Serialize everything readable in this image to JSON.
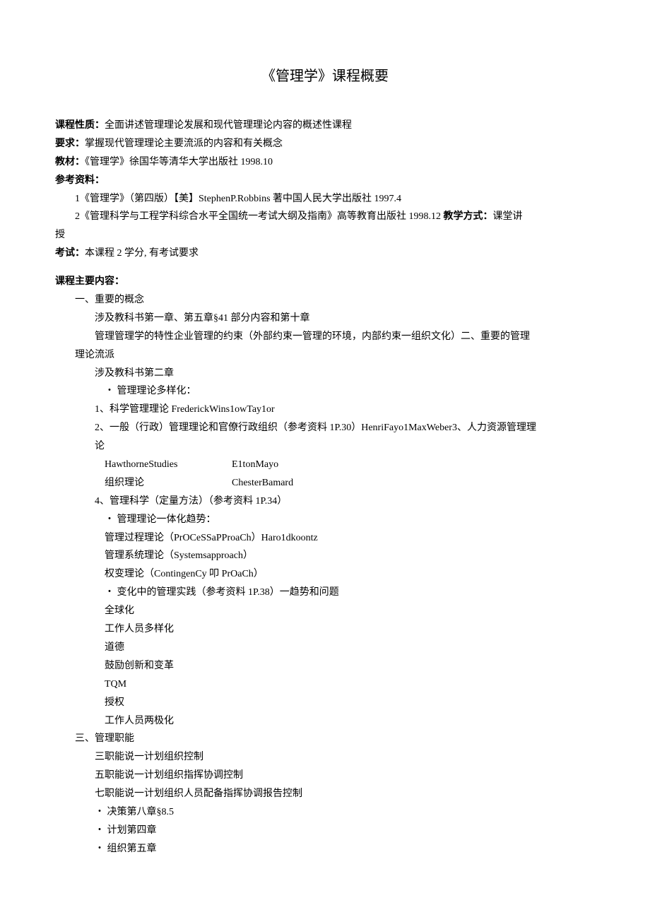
{
  "title": "《管理学》课程概要",
  "header": {
    "nature_label": "课程性质：",
    "nature_value": "全面讲述管理理论发展和现代管理理论内容的概述性课程",
    "req_label": "要求：",
    "req_value": "掌握现代管理理论主要流派的内容和有关概念",
    "textbook_label": "教材：",
    "textbook_value": "《管理学》徐国华等清华大学出版社 1998.10",
    "refs_label": "参考资料：",
    "ref1": "1《管理学》（第四版）【美】StephenP.Robbins 著中国人民大学出版社 1997.4",
    "ref2_a": "2《管理科学与工程学科综合水平全国统一考试大纲及指南》高等教育出版社 1998.12 ",
    "ref2_teach_label": "教学方式：",
    "ref2_teach_value": "课堂讲",
    "ref2_line2": "授",
    "exam_label": "考试：",
    "exam_value": "本课程 2 学分, 有考试要求"
  },
  "main_label": "课程主要内容：",
  "sec1": {
    "heading": "一、重要的概念",
    "l1": "涉及教科书第一章、第五章§41 部分内容和第十章",
    "l2": "管理管理学的特性企业管理的约束（外部约束一管理的环境，内部约束一组织文化）二、重要的管理",
    "l2b": "理论流派",
    "l3": "涉及教科书第二章",
    "bullet1": "・ 管理理论多样化：",
    "n1": "1、科学管理理论 FrederickWins1owTay1or",
    "n2": "2、一般（行政）管理理论和官僚行政组织（参考资料 1P.30）HenriFayo1MaxWeber3、人力资源管理理",
    "n2b": "论",
    "row1_a": "HawthorneStudies",
    "row1_b": "E1tonMayo",
    "row2_a": "组织理论",
    "row2_b": "ChesterBamard",
    "n4": "4、管理科学（定量方法）（参考资料 1P.34）",
    "bullet2": "・ 管理理论一体化趋势：",
    "t1": "管理过程理论（PrOCeSSaPProaCh）Haro1dkoontz",
    "t2": "管理系统理论（Systemsapproach）",
    "t3": "权变理论（ContingenCy 叩 PrOaCh）",
    "bullet3": "・ 变化中的管理实践（参考资料 1P.38）一趋势和问题",
    "p1": "全球化",
    "p2": "工作人员多样化",
    "p3": "道德",
    "p4": "鼓励创新和变革",
    "p5": "TQM",
    "p6": "授权",
    "p7": "工作人员两极化"
  },
  "sec3": {
    "heading": "三、管理职能",
    "l1": "三职能说一计划组织控制",
    "l2": "五职能说一计划组织指挥协调控制",
    "l3": "七职能说一计划组织人员配备指挥协调报告控制",
    "b1": "・ 决策第八章§8.5",
    "b2": "・ 计划第四章",
    "b3": "・ 组织第五章"
  }
}
